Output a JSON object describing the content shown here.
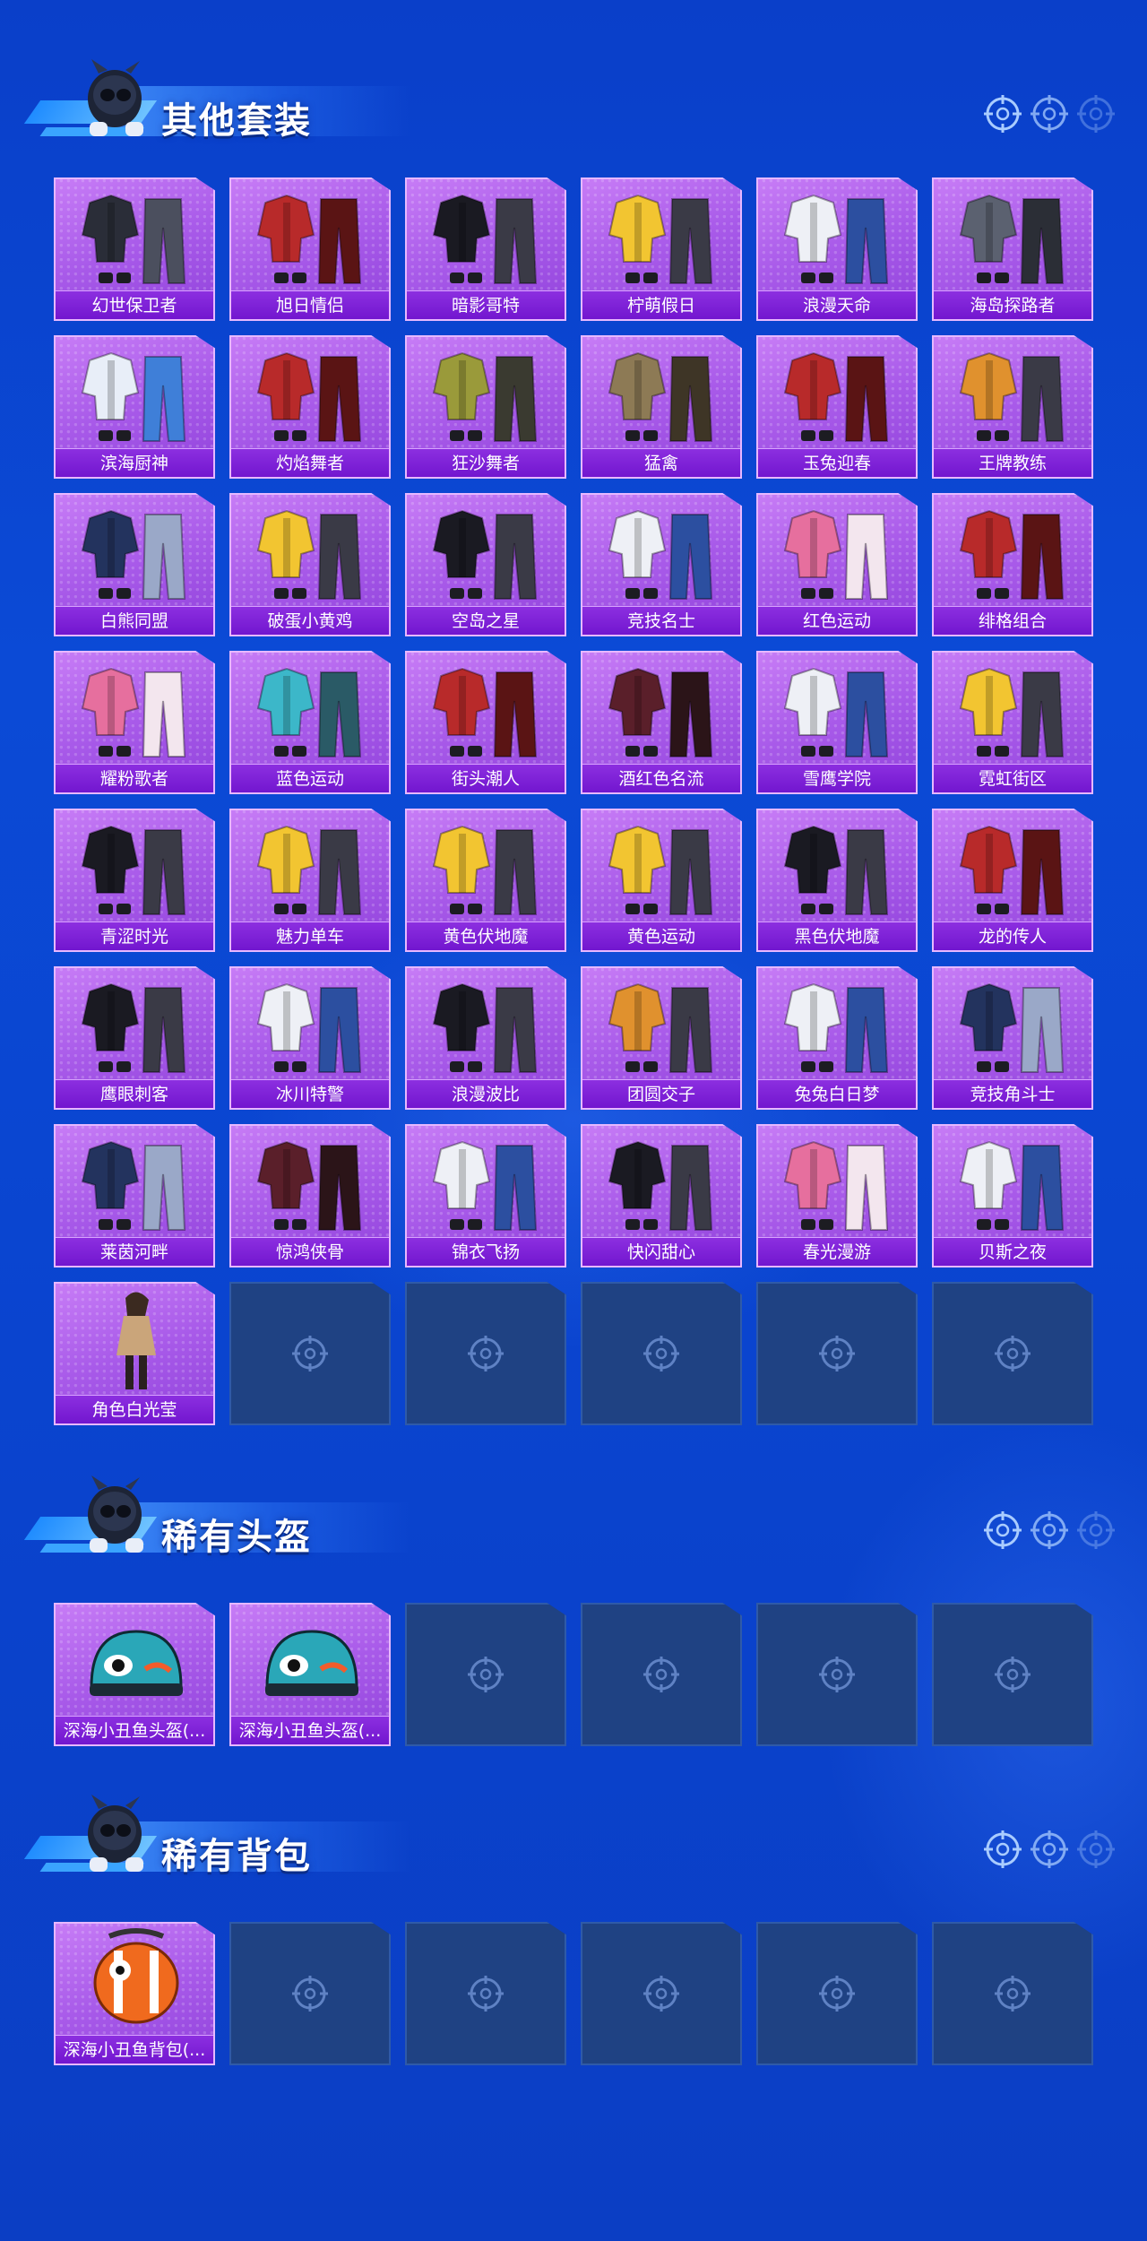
{
  "sections": [
    {
      "title": "其他套装",
      "items": [
        {
          "name": "幻世保卫者",
          "kind": "suit-dark"
        },
        {
          "name": "旭日情侣",
          "kind": "suit-red"
        },
        {
          "name": "暗影哥特",
          "kind": "suit-black"
        },
        {
          "name": "柠萌假日",
          "kind": "suit-yellow"
        },
        {
          "name": "浪漫天命",
          "kind": "suit-white"
        },
        {
          "name": "海岛探路者",
          "kind": "suit-grey"
        },
        {
          "name": "滨海厨神",
          "kind": "suit-blue"
        },
        {
          "name": "灼焰舞者",
          "kind": "suit-red"
        },
        {
          "name": "狂沙舞者",
          "kind": "suit-olive"
        },
        {
          "name": "猛禽",
          "kind": "suit-tan"
        },
        {
          "name": "玉兔迎春",
          "kind": "suit-red"
        },
        {
          "name": "王牌教练",
          "kind": "suit-orange"
        },
        {
          "name": "白熊同盟",
          "kind": "suit-navy"
        },
        {
          "name": "破蛋小黄鸡",
          "kind": "suit-yellow"
        },
        {
          "name": "空岛之星",
          "kind": "suit-black"
        },
        {
          "name": "竞技名士",
          "kind": "suit-white"
        },
        {
          "name": "红色运动",
          "kind": "suit-pink"
        },
        {
          "name": "绯格组合",
          "kind": "suit-red"
        },
        {
          "name": "耀粉歌者",
          "kind": "suit-pink"
        },
        {
          "name": "蓝色运动",
          "kind": "suit-teal"
        },
        {
          "name": "街头潮人",
          "kind": "suit-red"
        },
        {
          "name": "酒红色名流",
          "kind": "suit-wine"
        },
        {
          "name": "雪鹰学院",
          "kind": "suit-white"
        },
        {
          "name": "霓虹街区",
          "kind": "suit-yellow"
        },
        {
          "name": "青涩时光",
          "kind": "suit-black"
        },
        {
          "name": "魅力单车",
          "kind": "suit-yellow"
        },
        {
          "name": "黄色伏地魔",
          "kind": "suit-yellow"
        },
        {
          "name": "黄色运动",
          "kind": "suit-yellow"
        },
        {
          "name": "黑色伏地魔",
          "kind": "suit-black"
        },
        {
          "name": "龙的传人",
          "kind": "suit-red"
        },
        {
          "name": "鹰眼刺客",
          "kind": "suit-black"
        },
        {
          "name": "冰川特警",
          "kind": "suit-white"
        },
        {
          "name": "浪漫波比",
          "kind": "suit-black"
        },
        {
          "name": "团圆交子",
          "kind": "suit-orange"
        },
        {
          "name": "兔兔白日梦",
          "kind": "suit-white"
        },
        {
          "name": "竞技角斗士",
          "kind": "suit-navy"
        },
        {
          "name": "莱茵河畔",
          "kind": "suit-navy"
        },
        {
          "name": "惊鸿侠骨",
          "kind": "suit-wine"
        },
        {
          "name": "锦衣飞扬",
          "kind": "suit-white"
        },
        {
          "name": "快闪甜心",
          "kind": "suit-black"
        },
        {
          "name": "春光漫游",
          "kind": "suit-pink"
        },
        {
          "name": "贝斯之夜",
          "kind": "suit-white"
        },
        {
          "name": "角色白光莹",
          "kind": "character"
        }
      ],
      "empty_slots": 5
    },
    {
      "title": "稀有头盔",
      "items": [
        {
          "name": "深海小丑鱼头盔(...",
          "kind": "helmet-teal"
        },
        {
          "name": "深海小丑鱼头盔(...",
          "kind": "helmet-teal"
        }
      ],
      "empty_slots": 4
    },
    {
      "title": "稀有背包",
      "items": [
        {
          "name": "深海小丑鱼背包(...",
          "kind": "backpack-orange"
        }
      ],
      "empty_slots": 5
    }
  ],
  "colors": {
    "background": "#0b47d3",
    "card_filled": "#a85ae9",
    "card_label": "#7a1ed3",
    "card_empty": "#1f4283",
    "target_icon": "#9fc6ff"
  },
  "icons": {
    "header_mascot": "mascot-icon",
    "header_decor": "crosshair-target-icon",
    "empty_slot": "crosshair-target-icon"
  }
}
